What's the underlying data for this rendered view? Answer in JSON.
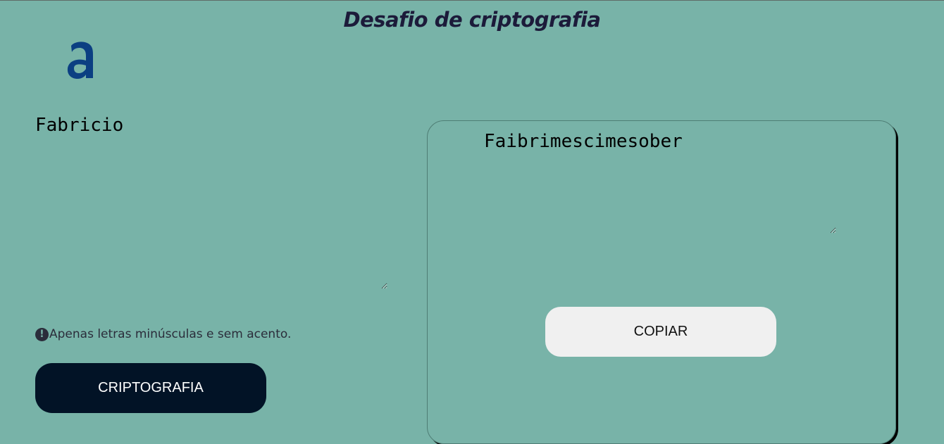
{
  "header": {
    "title": "Desafio de criptografia"
  },
  "logo": {
    "icon": "alura-logo-icon",
    "color": "#0b3f82"
  },
  "input": {
    "value": "Fabricio",
    "placeholder": ""
  },
  "hint": {
    "icon": "exclamation-circle-icon",
    "text": "Apenas letras minúsculas e sem acento."
  },
  "actions": {
    "encrypt_label": "CRIPTOGRAFIA"
  },
  "output": {
    "value": "Faibrimescimesober",
    "copy_label": "COPIAR"
  },
  "colors": {
    "background": "#78b3a8",
    "title": "#1c1b3a",
    "encrypt_button": "#021326",
    "copy_button": "#f0f0f0"
  }
}
